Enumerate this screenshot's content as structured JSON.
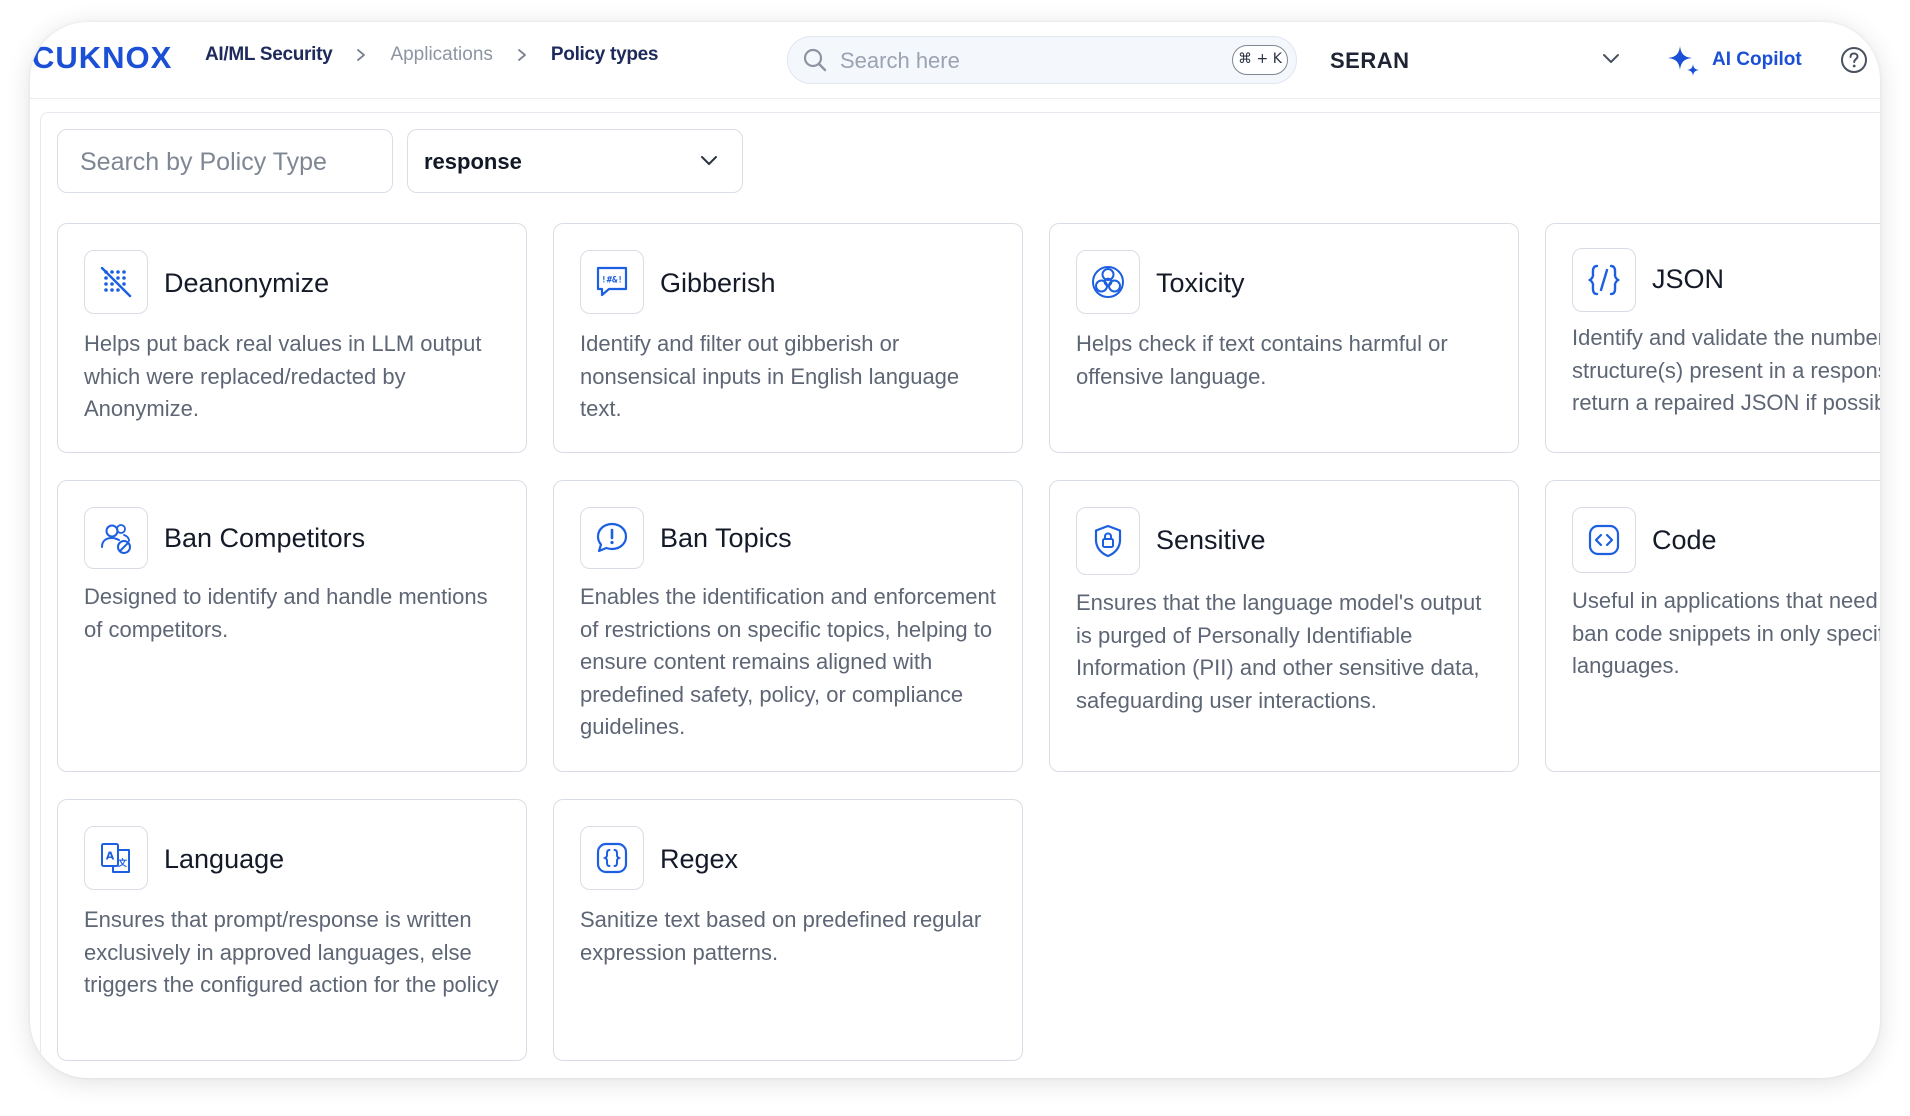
{
  "header": {
    "logo": "CUKNOX",
    "breadcrumbs": [
      {
        "label": "AI/ML Security"
      },
      {
        "label": "Applications"
      },
      {
        "label": "Policy types"
      }
    ],
    "search_placeholder": "Search here",
    "search_shortcut": "⌘ + K",
    "tenant": "SERAN",
    "copilot_label": "AI Copilot"
  },
  "filters": {
    "policy_search_placeholder": "Search by Policy Type",
    "type_value": "response"
  },
  "colors": {
    "brand": "#1a4fd6",
    "icon": "#1c5fe0",
    "text": "#141a28",
    "muted": "#5e6675"
  },
  "cards": [
    {
      "title": "Deanonymize",
      "icon": "crossed-grid-icon",
      "description": "Helps put back real values in LLM output which were replaced/redacted by Anonymize."
    },
    {
      "title": "Gibberish",
      "icon": "gibberish-chat-icon",
      "description": "Identify and filter out gibberish or nonsensical inputs in English language text."
    },
    {
      "title": "Toxicity",
      "icon": "biohazard-icon",
      "description": "Helps check if text contains harmful or offensive language."
    },
    {
      "title": "JSON",
      "icon": "json-braces-icon",
      "description": "Identify and validate the number of JSON structure(s) present in a response and return a repaired JSON if possible."
    },
    {
      "title": "Ban Competitors",
      "icon": "users-blocked-icon",
      "description": "Designed to identify and handle mentions of competitors."
    },
    {
      "title": "Ban Topics",
      "icon": "alert-bubble-icon",
      "description": "Enables the identification and enforcement of restrictions on specific topics, helping to ensure content remains aligned with predefined safety, policy, or compliance guidelines."
    },
    {
      "title": "Sensitive",
      "icon": "shield-lock-icon",
      "description": "Ensures that the language model's output is purged of Personally Identifiable Information (PII) and other sensitive data, safeguarding user interactions."
    },
    {
      "title": "Code",
      "icon": "code-icon",
      "description": "Useful in applications that need to allow or ban code snippets in only specific languages."
    },
    {
      "title": "Language",
      "icon": "translate-icon",
      "description": "Ensures that prompt/response is written exclusively in approved languages, else triggers the configured action for the policy"
    },
    {
      "title": "Regex",
      "icon": "regex-braces-icon",
      "description": "Sanitize text based on predefined regular expression patterns."
    }
  ]
}
